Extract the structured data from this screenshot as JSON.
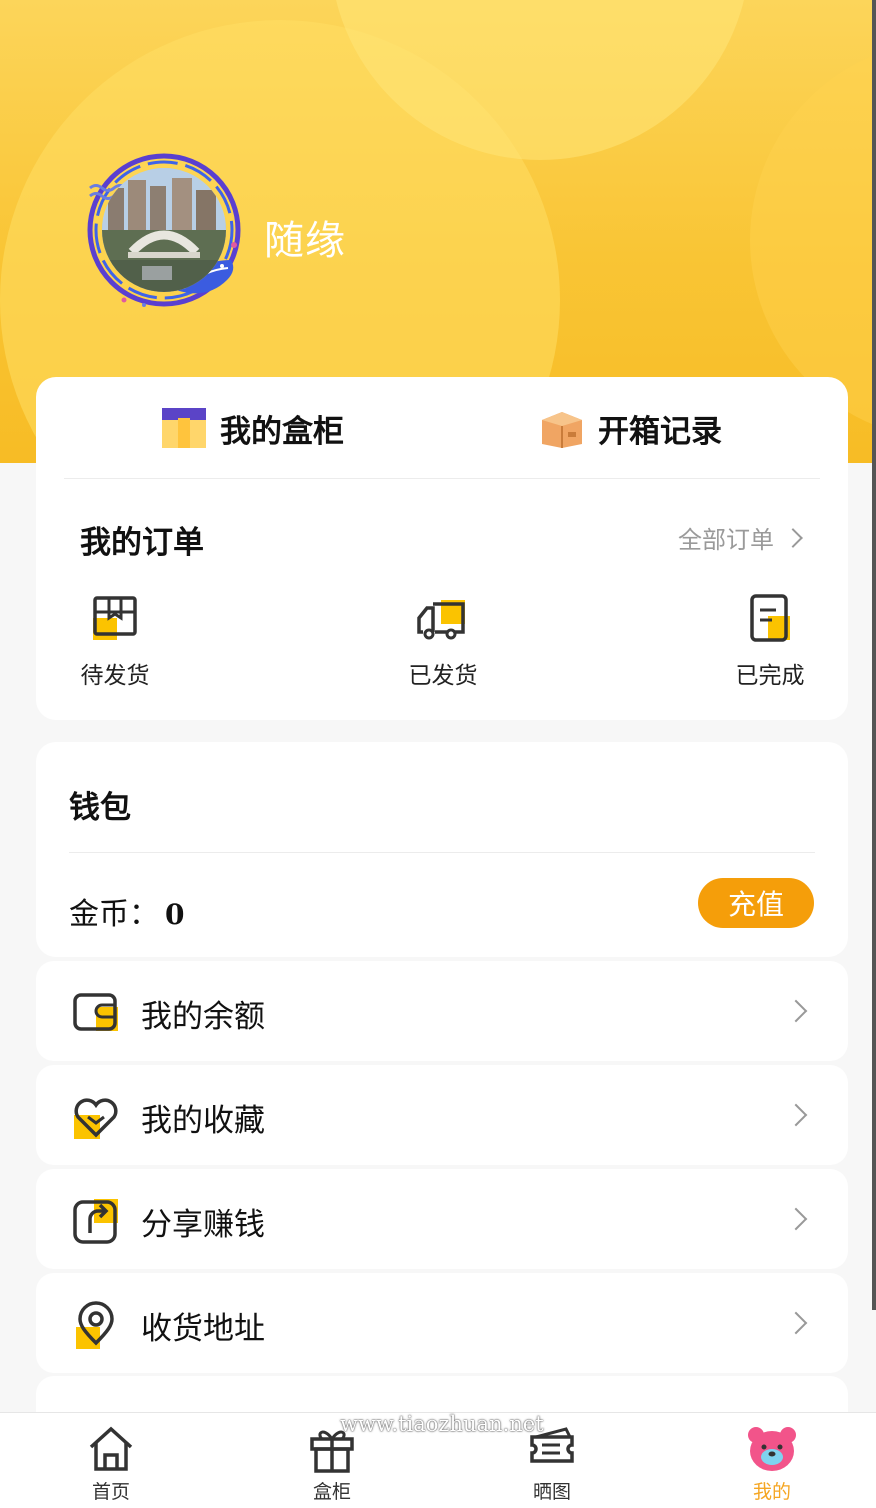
{
  "profile": {
    "username": "随缘",
    "avatar": "avatar-photo"
  },
  "tabs": [
    {
      "label": "我的盒柜",
      "icon": "box-icon"
    },
    {
      "label": "开箱记录",
      "icon": "open-box-icon"
    }
  ],
  "orders": {
    "title": "我的订单",
    "all_label": "全部订单",
    "items": [
      {
        "label": "待发货",
        "icon": "package-icon"
      },
      {
        "label": "已发货",
        "icon": "truck-icon"
      },
      {
        "label": "已完成",
        "icon": "document-icon"
      }
    ]
  },
  "wallet": {
    "title": "钱包",
    "coin_label": "金币：",
    "coin_value": "0",
    "recharge_label": "充值"
  },
  "menu": [
    {
      "label": "我的余额",
      "icon": "wallet-icon"
    },
    {
      "label": "我的收藏",
      "icon": "heart-icon"
    },
    {
      "label": "分享赚钱",
      "icon": "share-icon"
    },
    {
      "label": "收货地址",
      "icon": "location-icon"
    }
  ],
  "tabbar": [
    {
      "label": "首页",
      "icon": "home-icon"
    },
    {
      "label": "盒柜",
      "icon": "gift-icon"
    },
    {
      "label": "晒图",
      "icon": "ticket-icon"
    },
    {
      "label": "我的",
      "icon": "bear-icon",
      "active": true
    }
  ],
  "watermark": "www.tiaozhuan.net",
  "colors": {
    "accent": "#f59e0a",
    "header_yellow": "#f9c535",
    "icon_yellow": "#fbc300",
    "active_tab": "#f5a623"
  }
}
